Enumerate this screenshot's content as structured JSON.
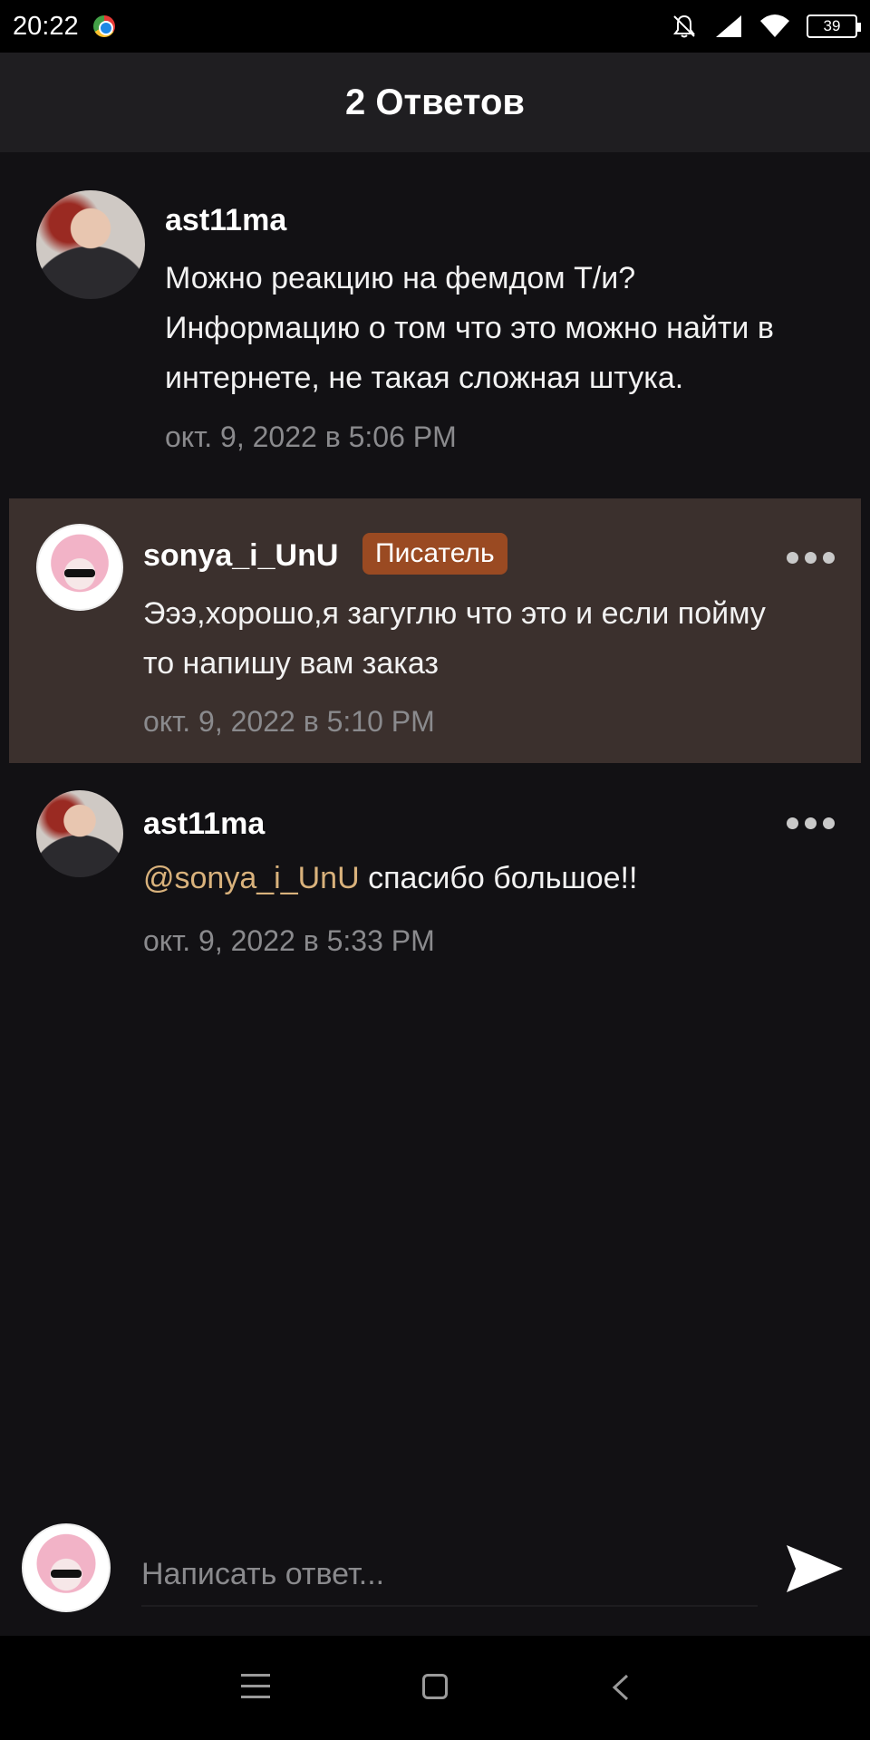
{
  "status_bar": {
    "time": "20:22",
    "battery": "39",
    "icons": [
      "chrome-icon",
      "bell-muted-icon",
      "signal-icon",
      "wifi-icon",
      "battery-icon"
    ]
  },
  "header": {
    "title": "2 Ответов"
  },
  "comments": [
    {
      "username": "ast11ma",
      "text_lines": [
        "Можно реакцию на фемдом Т/и?",
        "Информацию о том что это можно найти в",
        "интернете, не такая сложная штука."
      ],
      "timestamp": "окт. 9, 2022 в 5:06 PM"
    },
    {
      "username": "sonya_i_UnU",
      "badge": "Писатель",
      "text_lines": [
        "Эээ,хорошо,я загуглю что это и если пойму",
        "то напишу вам заказ"
      ],
      "timestamp": "окт. 9, 2022 в 5:10 PM",
      "highlighted": true
    },
    {
      "username": "ast11ma",
      "mention": "@sonya_i_UnU",
      "text": "спасибо большое!!",
      "timestamp": "окт. 9, 2022 в 5:33 PM"
    }
  ],
  "reply": {
    "placeholder": "Написать ответ..."
  },
  "colors": {
    "background": "#121114",
    "highlight": "#3b302d",
    "badge": "#9a4a22",
    "mention": "#d9b27c"
  }
}
